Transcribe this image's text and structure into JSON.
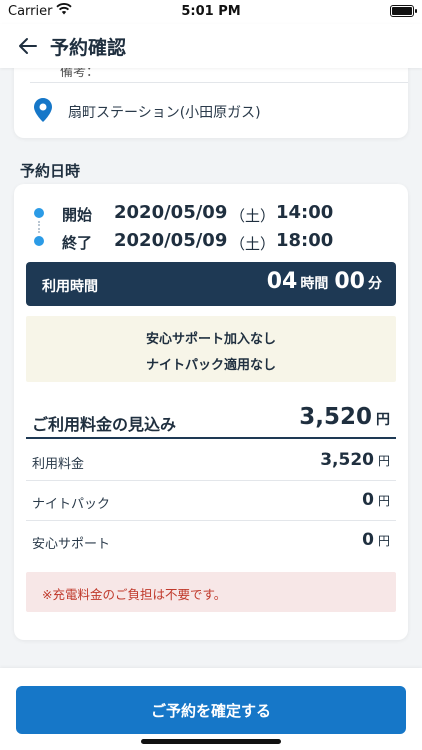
{
  "status_bar": {
    "carrier": "Carrier",
    "time": "5:01 PM"
  },
  "nav": {
    "title": "予約確認"
  },
  "station": {
    "clipped_label": "備考：",
    "name": "扇町ステーション(小田原ガス)"
  },
  "reservation": {
    "section_title": "予約日時",
    "start": {
      "label": "開始",
      "date": "2020/05/09",
      "weekday": "（土）",
      "time": "14:00"
    },
    "end": {
      "label": "終了",
      "date": "2020/05/09",
      "weekday": "（土）",
      "time": "18:00"
    },
    "usage": {
      "label": "利用時間",
      "hours": "04",
      "hours_unit": "時間",
      "minutes": "00",
      "minutes_unit": "分"
    },
    "notice": [
      "安心サポート加入なし",
      "ナイトパック適用なし"
    ]
  },
  "estimate": {
    "title": "ご利用料金の見込み",
    "total": "3,520",
    "currency": "円",
    "fees": [
      {
        "label": "利用料金",
        "value": "3,520"
      },
      {
        "label": "ナイトパック",
        "value": "0"
      },
      {
        "label": "安心サポート",
        "value": "0"
      }
    ],
    "alert": "※充電料金のご負担は不要です。"
  },
  "footer": {
    "confirm_label": "ご予約を確定する"
  },
  "colors": {
    "accent": "#1677c8",
    "navy": "#1e3954",
    "dot": "#2b9be6",
    "alert_text": "#c0392b"
  }
}
